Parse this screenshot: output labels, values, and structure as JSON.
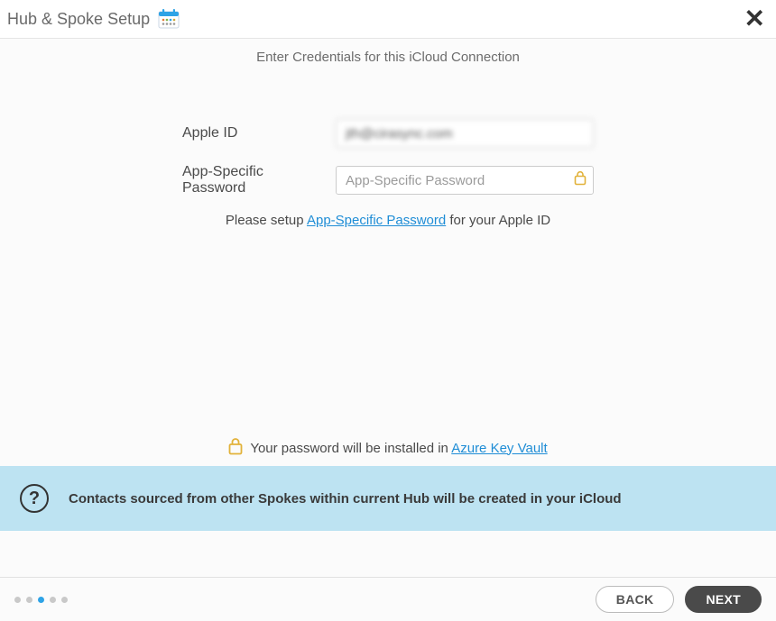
{
  "header": {
    "title": "Hub & Spoke Setup"
  },
  "instruction": "Enter Credentials for this iCloud Connection",
  "form": {
    "apple_id_label": "Apple ID",
    "apple_id_value": "jth@cirasync.com",
    "password_label": "App-Specific Password",
    "password_placeholder": "App-Specific Password"
  },
  "help": {
    "prefix": "Please setup ",
    "link": "App-Specific Password",
    "suffix": " for your Apple ID"
  },
  "vault": {
    "text": "Your password will be installed in ",
    "link": "Azure Key Vault"
  },
  "banner": {
    "text": "Contacts sourced from other Spokes within current Hub will be created in your iCloud"
  },
  "footer": {
    "back": "BACK",
    "next": "NEXT",
    "steps": 5,
    "active_step": 2
  }
}
